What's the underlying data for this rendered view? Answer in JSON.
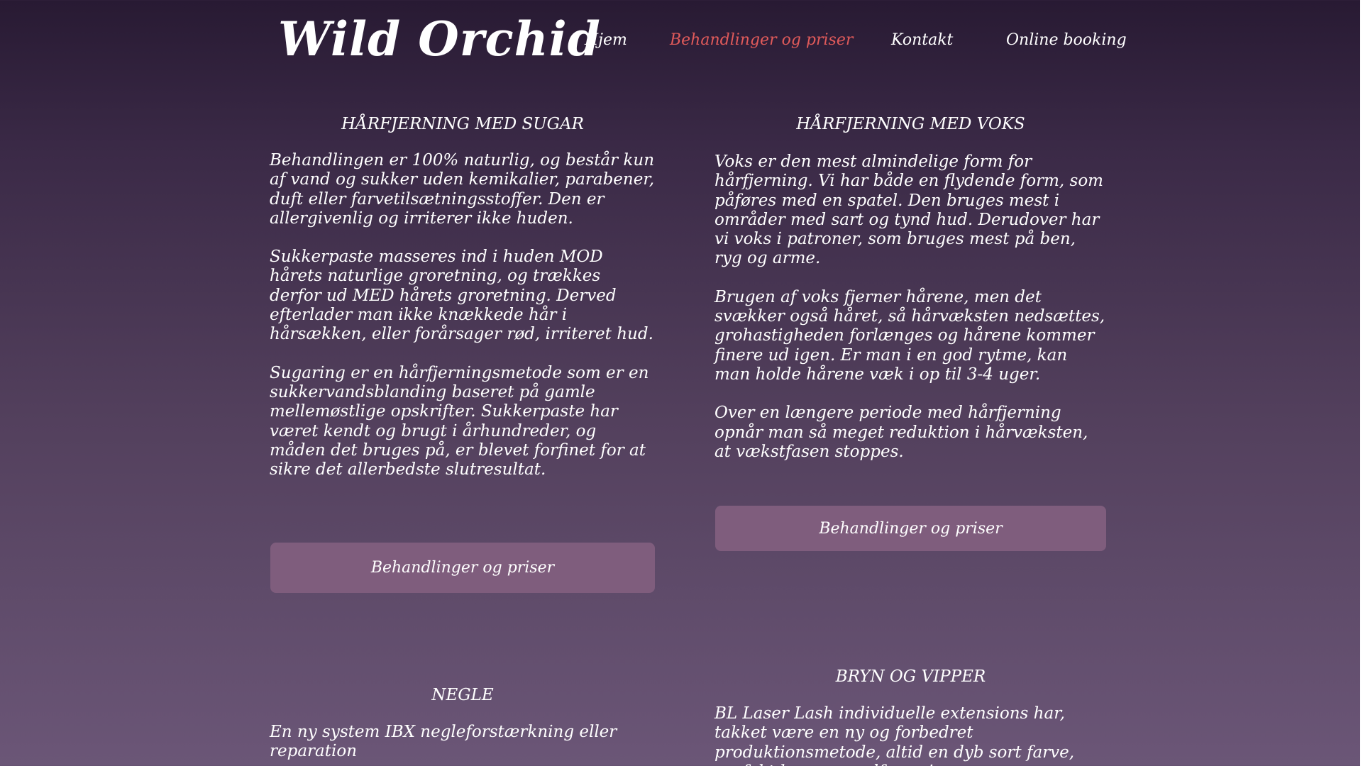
{
  "header": {
    "logo": "Wild Orchid",
    "nav": [
      {
        "label": "Hjem",
        "active": false
      },
      {
        "label": "Behandlinger og priser",
        "active": true
      },
      {
        "label": "Kontakt",
        "active": false
      },
      {
        "label": "Online booking",
        "active": false
      }
    ]
  },
  "sections": {
    "sugar": {
      "title": "HÅRFJERNING MED SUGAR",
      "paragraphs": [
        "Behandlingen er 100% naturlig, og består kun af vand og sukker uden kemikalier, parabener, duft eller farvetilsætningsstoffer. Den er allergivenlig og irriterer ikke huden.",
        "Sukkerpaste masseres ind i huden MOD hårets naturlige groretning, og trækkes derfor ud MED hårets groretning. Derved efterlader man ikke knækkede hår i hårsækken, eller forårsager rød, irriteret hud.",
        "Sugaring er en hårfjerningsmetode som er en sukkervandsblanding baseret på gamle mellemøstlige opskrifter. Sukkerpaste har været kendt og brugt i århundreder, og måden det bruges på, er blevet forfinet for at sikre det allerbedste slutresultat."
      ],
      "button": "Behandlinger og priser"
    },
    "voks": {
      "title": "HÅRFJERNING MED VOKS",
      "paragraphs": [
        "Voks er den mest almindelige form for hårfjerning. Vi har både en flydende form, som påføres med en spatel. Den bruges mest i områder med sart og tynd hud. Derudover har vi voks i patroner, som bruges mest på ben, ryg og arme.",
        "Brugen af voks fjerner hårene, men det svækker også håret, så hårvæksten nedsættes, grohastigheden forlænges og hårene kommer finere ud igen. Er man i en god rytme, kan man holde hårene væk i op til 3-4 uger.",
        "Over en længere periode med hårfjerning opnår man så meget reduktion i hårvæksten, at vækstfasen stoppes."
      ],
      "button": "Behandlinger og priser"
    },
    "negle": {
      "title": "NEGLE",
      "paragraphs": [
        "En ny system IBX negleforstærkning eller reparation"
      ]
    },
    "bryn": {
      "title": "BRYN OG VIPPER",
      "paragraphs": [
        "BL Laser Lash individuelle extensions har, takket være en ny og forbedret produktionsmetode, altid en dyb sort farve, perfekt kurve og udformning,"
      ]
    }
  },
  "colors": {
    "background_top": "#281a33",
    "background_bottom": "#6b5677",
    "nav_active": "#e05a5a",
    "button_bg": "#7f5d7d"
  }
}
